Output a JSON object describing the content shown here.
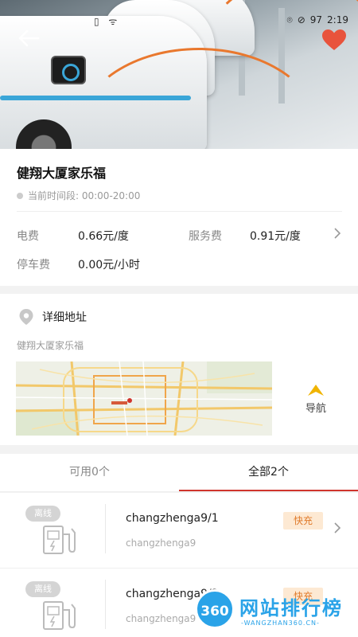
{
  "status_bar": {
    "time": "2:19",
    "battery": "97",
    "left_icons": "▯ ᯤ"
  },
  "header": {
    "back_icon": "back-arrow-icon",
    "favorite_icon": "heart-icon",
    "favorite_color": "#e8533c"
  },
  "station": {
    "name": "健翔大厦家乐福",
    "time_label": "当前时间段: 00:00-20:00",
    "fees": [
      {
        "label": "电费",
        "value": "0.66元/度"
      },
      {
        "label": "服务费",
        "value": "0.91元/度"
      },
      {
        "label": "停车费",
        "value": "0.00元/小时"
      }
    ]
  },
  "address": {
    "heading": "详细地址",
    "text": "健翔大厦家乐福",
    "nav_label": "导航",
    "nav_color": "#f0b400"
  },
  "tabs": [
    {
      "label": "可用0个",
      "active": false
    },
    {
      "label": "全部2个",
      "active": true
    }
  ],
  "accent_color": "#d0342c",
  "chargers": [
    {
      "status": "离线",
      "name": "changzhenga9/1",
      "sub": "changzhenga9",
      "type": "快充"
    },
    {
      "status": "离线",
      "name": "changzhenga9/2",
      "sub": "changzhenga9",
      "type": "快充"
    }
  ],
  "watermark": {
    "logo": "360",
    "title": "网站排行榜",
    "subtitle": "-WANGZHAN360.CN-"
  }
}
